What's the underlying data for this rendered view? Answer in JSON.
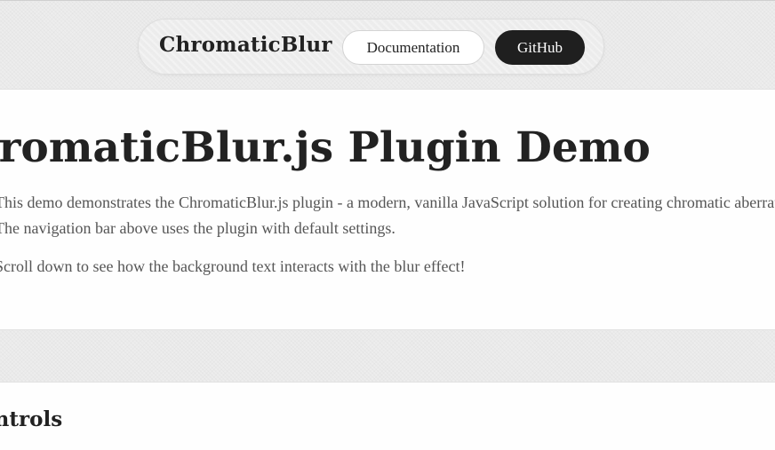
{
  "nav": {
    "brand": "ChromaticBlur",
    "docs_label": "Documentation",
    "github_label": "GitHub"
  },
  "hero": {
    "title": "ChromaticBlur.js Plugin Demo",
    "line1": "This demo demonstrates the ChromaticBlur.js plugin - a modern, vanilla JavaScript solution for creating chromatic aberration",
    "line2": "The navigation bar above uses the plugin with default settings.",
    "line3": "Scroll down to see how the background text interacts with the blur effect!"
  },
  "controls": {
    "title": "Controls"
  },
  "colors": {
    "accent_dark": "#1f1f1f",
    "page_bg": "#ededed",
    "panel_bg": "#fefefe"
  }
}
